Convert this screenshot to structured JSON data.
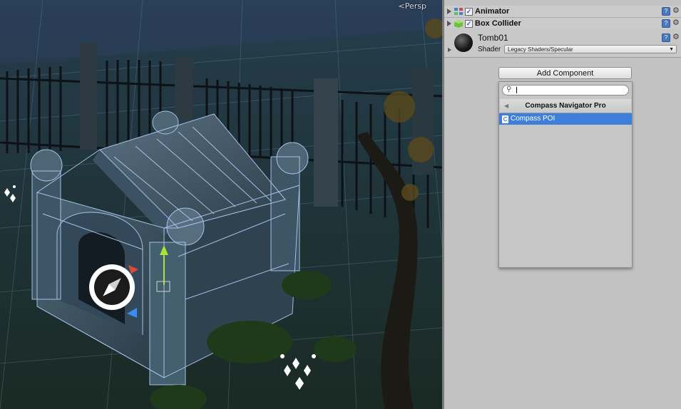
{
  "scene": {
    "view_label": "<Persp"
  },
  "inspector": {
    "components": [
      {
        "label": "Animator",
        "enabled": true,
        "icon": "animator-icon"
      },
      {
        "label": "Box Collider",
        "enabled": true,
        "icon": "box-collider-icon"
      }
    ],
    "material": {
      "name": "Tomb01",
      "shader_label": "Shader",
      "shader_value": "Legacy Shaders/Specular"
    },
    "add_component_label": "Add Component",
    "popup": {
      "search_value": "",
      "category_title": "Compass Navigator Pro",
      "items": [
        {
          "label": "Compass POI",
          "selected": true,
          "icon": "script-icon"
        }
      ]
    }
  },
  "colors": {
    "inspector_bg": "#c2c2c2",
    "selection": "#3e7fdb",
    "scene_ground": "#1f3a4a",
    "wireframe": "#b7d4ff"
  }
}
